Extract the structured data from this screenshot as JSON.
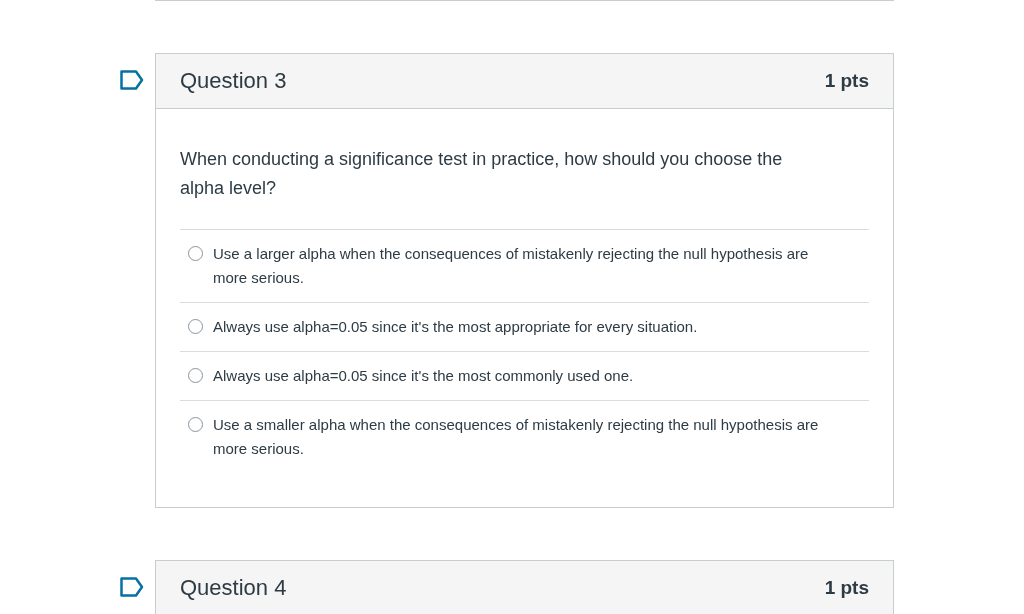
{
  "questions": [
    {
      "title": "Question 3",
      "points": "1 pts",
      "flagged": false,
      "text": "When conducting a significance test in practice, how should you choose the alpha level?",
      "answers": [
        {
          "label": "Use a larger alpha when the consequences of mistakenly rejecting the null hypothesis are more serious.",
          "selected": false
        },
        {
          "label": "Always use alpha=0.05 since it's the most appropriate for every situation.",
          "selected": false
        },
        {
          "label": "Always use alpha=0.05 since it's the most commonly used one.",
          "selected": false
        },
        {
          "label": "Use a smaller alpha when the consequences of mistakenly rejecting the null hypothesis are more serious.",
          "selected": false
        }
      ]
    },
    {
      "title": "Question 4",
      "points": "1 pts",
      "flagged": false
    }
  ]
}
